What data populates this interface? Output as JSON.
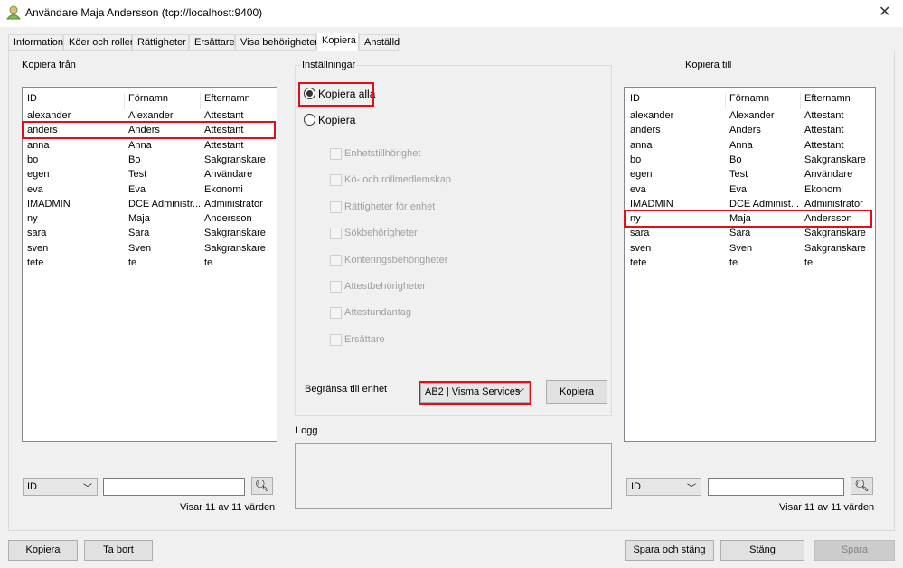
{
  "window": {
    "title": "Användare Maja Andersson (tcp://localhost:9400)",
    "close": "✕"
  },
  "tabs": [
    {
      "label": "Information"
    },
    {
      "label": "Köer och roller"
    },
    {
      "label": "Rättigheter"
    },
    {
      "label": "Ersättare"
    },
    {
      "label": "Visa behörigheter"
    },
    {
      "label": "Kopiera"
    },
    {
      "label": "Anställd"
    }
  ],
  "active_tab": "Kopiera",
  "columns": [
    "ID",
    "Förnamn",
    "Efternamn"
  ],
  "from": {
    "title": "Kopiera från",
    "selected": "anders",
    "rows": [
      [
        "alexander",
        "Alexander",
        "Attestant"
      ],
      [
        "anders",
        "Anders",
        "Attestant"
      ],
      [
        "anna",
        "Anna",
        "Attestant"
      ],
      [
        "bo",
        "Bo",
        "Sakgranskare"
      ],
      [
        "egen",
        "Test",
        "Användare"
      ],
      [
        "eva",
        "Eva",
        "Ekonomi"
      ],
      [
        "IMADMIN",
        "DCE Administr...",
        "Administrator"
      ],
      [
        "ny",
        "Maja",
        "Andersson"
      ],
      [
        "sara",
        "Sara",
        "Sakgranskare"
      ],
      [
        "sven",
        "Sven",
        "Sakgranskare"
      ],
      [
        "tete",
        "te",
        "te"
      ]
    ],
    "filter_field": "ID",
    "search_value": "",
    "status": "Visar 11 av 11 värden"
  },
  "to": {
    "title": "Kopiera till",
    "selected": "ny",
    "rows": [
      [
        "alexander",
        "Alexander",
        "Attestant"
      ],
      [
        "anders",
        "Anders",
        "Attestant"
      ],
      [
        "anna",
        "Anna",
        "Attestant"
      ],
      [
        "bo",
        "Bo",
        "Sakgranskare"
      ],
      [
        "egen",
        "Test",
        "Användare"
      ],
      [
        "eva",
        "Eva",
        "Ekonomi"
      ],
      [
        "IMADMIN",
        "DCE Administ...",
        "Administrator"
      ],
      [
        "ny",
        "Maja",
        "Andersson"
      ],
      [
        "sara",
        "Sara",
        "Sakgranskare"
      ],
      [
        "sven",
        "Sven",
        "Sakgranskare"
      ],
      [
        "tete",
        "te",
        "te"
      ]
    ],
    "filter_field": "ID",
    "search_value": "",
    "status": "Visar 11 av 11 värden"
  },
  "settings": {
    "title": "Inställningar",
    "radio_all": "Kopiera alla",
    "radio_some": "Kopiera",
    "selected_radio": "Kopiera alla",
    "checkboxes": [
      "Enhetstillhörighet",
      "Kö- och rollmedlemskap",
      "Rättigheter för enhet",
      "Sökbehörigheter",
      "Konteringsbehörigheter",
      "Attestbehörigheter",
      "Attestundantag",
      "Ersättare"
    ],
    "limit_label": "Begränsa till enhet",
    "limit_value": "AB2 | Visma Services",
    "copy_button": "Kopiera"
  },
  "log": {
    "title": "Logg",
    "content": ""
  },
  "footer": {
    "copy": "Kopiera",
    "remove": "Ta bort",
    "save_close": "Spara och stäng",
    "close": "Stäng",
    "save": "Spara"
  },
  "colors": {
    "highlight": "#e0101a"
  }
}
